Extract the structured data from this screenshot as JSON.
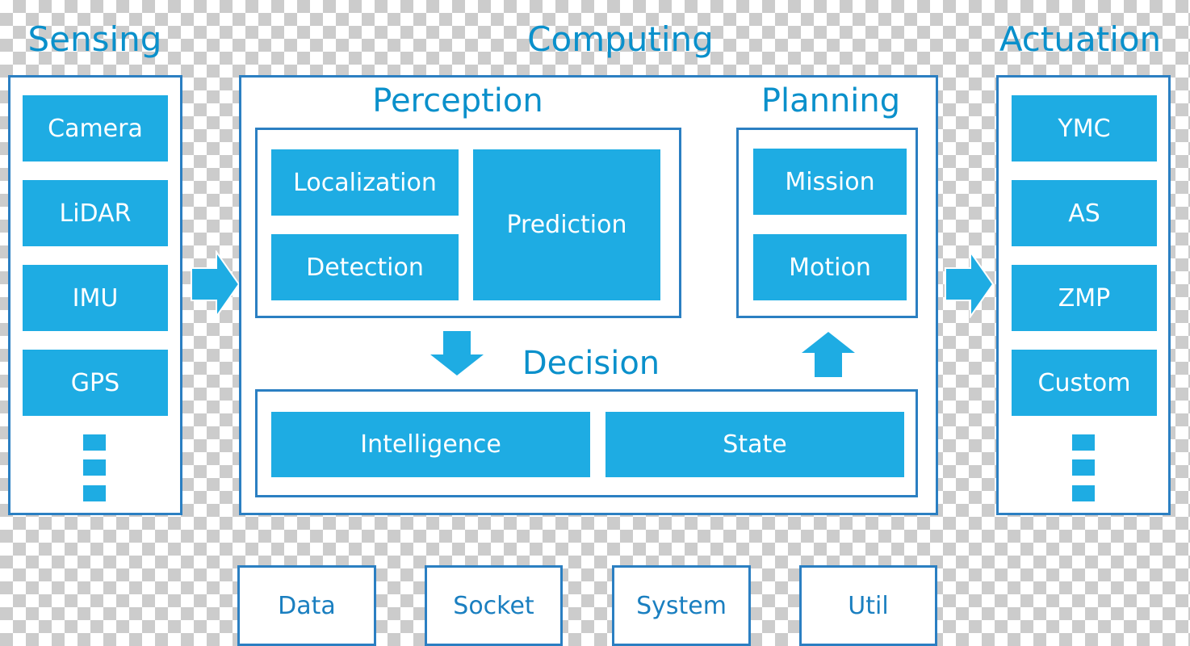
{
  "colors": {
    "accent": "#1eace3",
    "border": "#2b7fc2",
    "title": "#0a90cb"
  },
  "sensing": {
    "title": "Sensing",
    "items": [
      "Camera",
      "LiDAR",
      "IMU",
      "GPS"
    ]
  },
  "computing": {
    "title": "Computing",
    "perception": {
      "title": "Perception",
      "items": [
        "Localization",
        "Detection",
        "Prediction"
      ]
    },
    "planning": {
      "title": "Planning",
      "items": [
        "Mission",
        "Motion"
      ]
    },
    "decision": {
      "title": "Decision",
      "items": [
        "Intelligence",
        "State"
      ]
    }
  },
  "actuation": {
    "title": "Actuation",
    "items": [
      "YMC",
      "AS",
      "ZMP",
      "Custom"
    ]
  },
  "utilities": [
    "Data",
    "Socket",
    "System",
    "Util"
  ]
}
